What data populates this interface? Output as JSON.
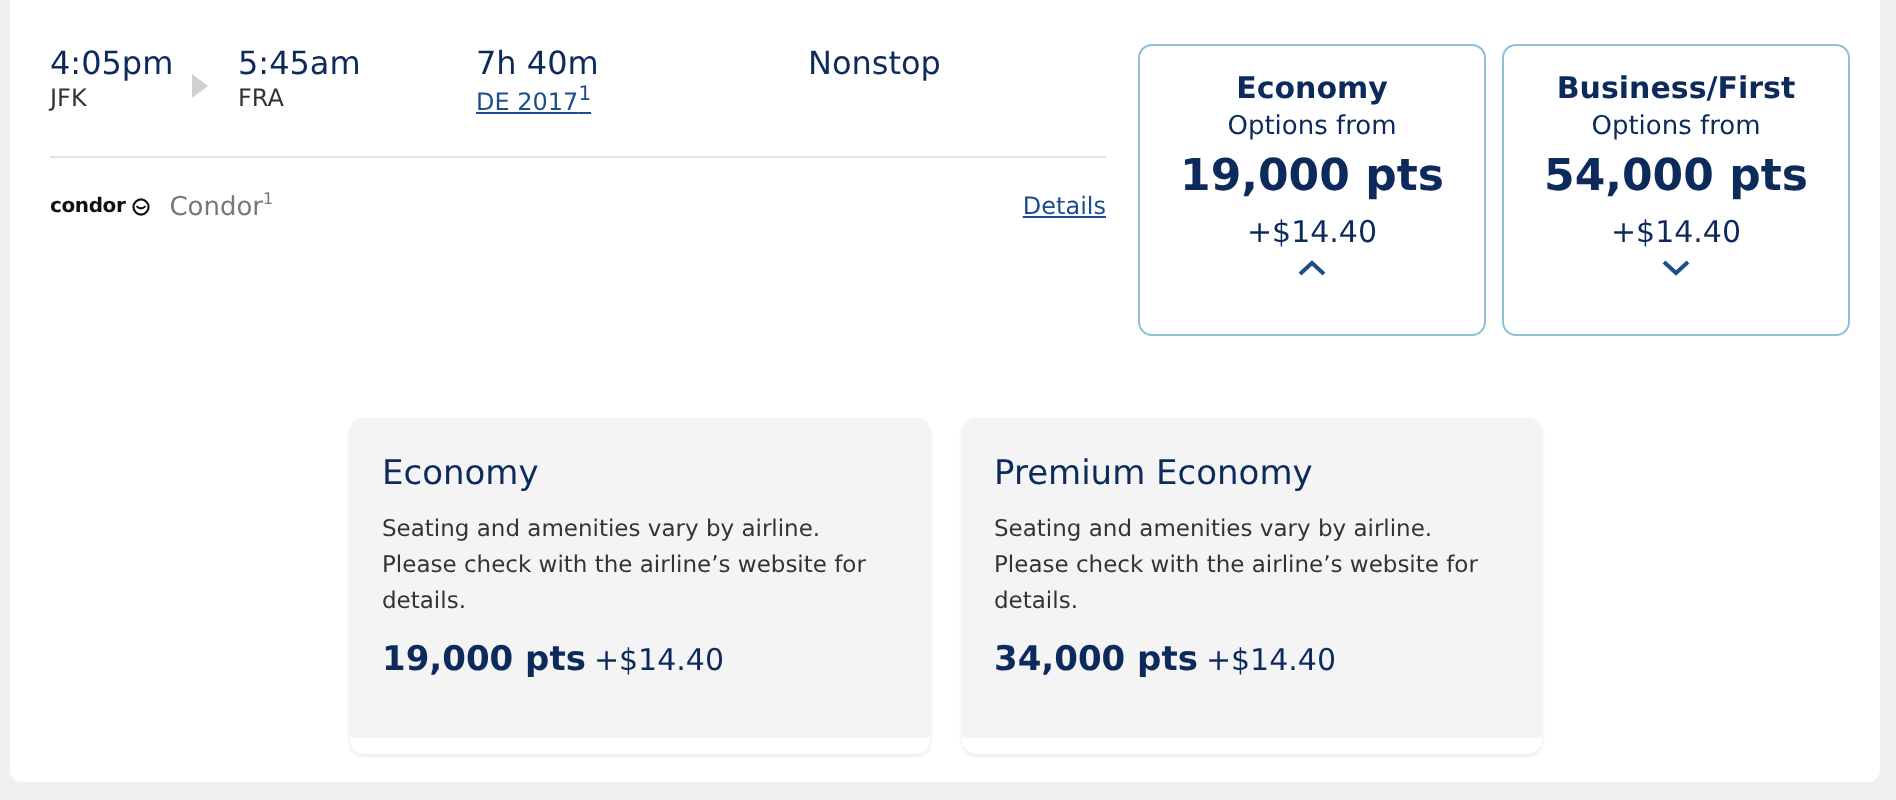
{
  "flight": {
    "depart_time": "4:05pm",
    "depart_airport": "JFK",
    "arrive_time": "5:45am",
    "arrive_airport": "FRA",
    "duration": "7h 40m",
    "flight_number": "DE 2017$^{1}$",
    "stops": "Nonstop",
    "airline_logo": "condor",
    "airline": "Condor$^{1}$",
    "details_link": "Details"
  },
  "fares": [
    {
      "cabin": "Economy",
      "subtitle": "Options from",
      "points": "19,000 pts",
      "fee": "+$14.40",
      "expanded": true
    },
    {
      "cabin": "Business/First",
      "subtitle": "Options from",
      "points": "54,000 pts",
      "fee": "+$14.40",
      "expanded": false
    }
  ],
  "cabin_options": [
    {
      "title": "Economy",
      "description": "Seating and amenities vary by airline. Please check with the airline’s website for details.",
      "points": "19,000 pts",
      "fee": "+$14.40"
    },
    {
      "title": "Premium Economy",
      "description": "Seating and amenities vary by airline. Please check with the airline’s website for details.",
      "points": "34,000 pts",
      "fee": "+$14.40"
    }
  ]
}
